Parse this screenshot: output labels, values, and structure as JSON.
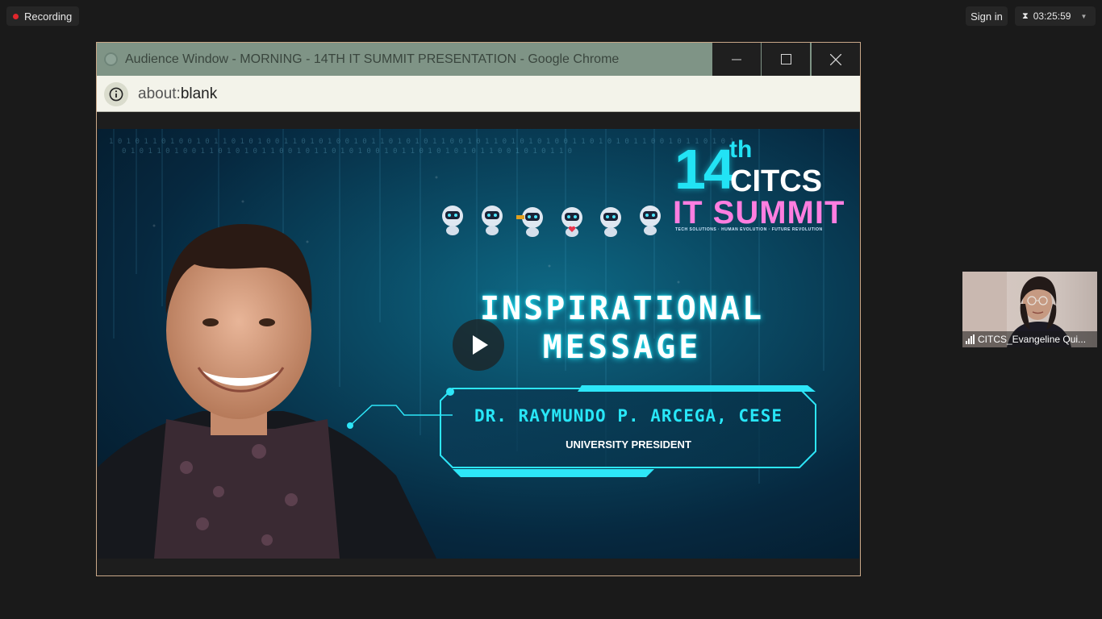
{
  "top_bar": {
    "recording_label": "Recording",
    "sign_in_label": "Sign in",
    "timer": "03:25:59"
  },
  "browser": {
    "title": "Audience Window - MORNING - 14TH IT SUMMIT PRESENTATION - Google Chrome",
    "url_scheme": "about:",
    "url_rest": "blank",
    "controls": [
      "minimize-icon",
      "maximize-icon",
      "close-icon"
    ]
  },
  "slide": {
    "brand_number": "14",
    "brand_suffix": "th",
    "brand_org": "CITCS",
    "brand_event": "IT SUMMIT",
    "brand_tagline": "TECH SOLUTIONS · HUMAN EVOLUTION · FUTURE REVOLUTION",
    "heading_line1": "INSPIRATIONAL",
    "heading_line2": "MESSAGE",
    "speaker_name": "DR. RAYMUNDO P. ARCEGA, CESE",
    "speaker_role": "UNIVERSITY PRESIDENT"
  },
  "participant": {
    "name": "CITCS_Evangeline Qui..."
  },
  "colors": {
    "accent_cyan": "#22e3f5",
    "accent_pink": "#ff7ee0",
    "record_red": "#e0262c"
  }
}
